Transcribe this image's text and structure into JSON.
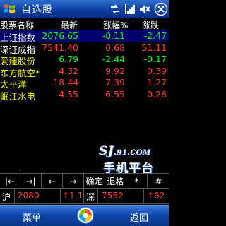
{
  "window": {
    "title": "自选股",
    "status_icons": [
      "connectivity-icon",
      "signal-icon",
      "volume-icon",
      "close-icon"
    ]
  },
  "header": {
    "name": "股票名称",
    "price": "最新",
    "pct": "涨幅%",
    "change": "涨跌"
  },
  "stocks": [
    {
      "name": "上证指数",
      "price": "2076.65",
      "pct": "-0.11",
      "change": "-2.47",
      "color": "#00ff00",
      "name_color": "#ffffff",
      "selected": true
    },
    {
      "name": "深证成指",
      "price": "7541.40",
      "pct": "0.68",
      "change": "51.11",
      "color": "#ff3b3b",
      "name_color": "#ffffff"
    },
    {
      "name": "爱建股份",
      "price": "6.79",
      "pct": "-2.44",
      "change": "-0.17",
      "color": "#00ff00",
      "name_color": "#ffff00"
    },
    {
      "name": "东方航空*",
      "price": "4.32",
      "pct": "9.92",
      "change": "0.39",
      "color": "#ff3b3b",
      "name_color": "#ffff00"
    },
    {
      "name": "太平洋",
      "price": "18.44",
      "pct": "7.39",
      "change": "1.27",
      "color": "#ff3b3b",
      "name_color": "#ffff00"
    },
    {
      "name": "岷江水电",
      "price": "4.55",
      "pct": "6.55",
      "change": "0.28",
      "color": "#ff3b3b",
      "name_color": "#ffff00"
    }
  ],
  "watermark": {
    "line1_a": "SJ",
    "line1_b": ".91.",
    "line1_c": "COM",
    "line2": "手机平台"
  },
  "buttons": [
    "|←",
    "→|",
    "←",
    "→",
    "确定",
    "退格",
    "*",
    "#"
  ],
  "index_bar": {
    "sh_label": "沪",
    "sh_value": "2080",
    "sh_change": "↑1.1",
    "sz_label": "深",
    "sz_value": "7552",
    "sz_change": "↑62"
  },
  "softkeys": {
    "left": "菜单",
    "right": "返回"
  },
  "colors": {
    "up": "#ff3b3b",
    "down": "#00ff00",
    "name_default": "#ffff00",
    "selected_bg": "#00006c",
    "titlebar": "#0b3fa0"
  }
}
